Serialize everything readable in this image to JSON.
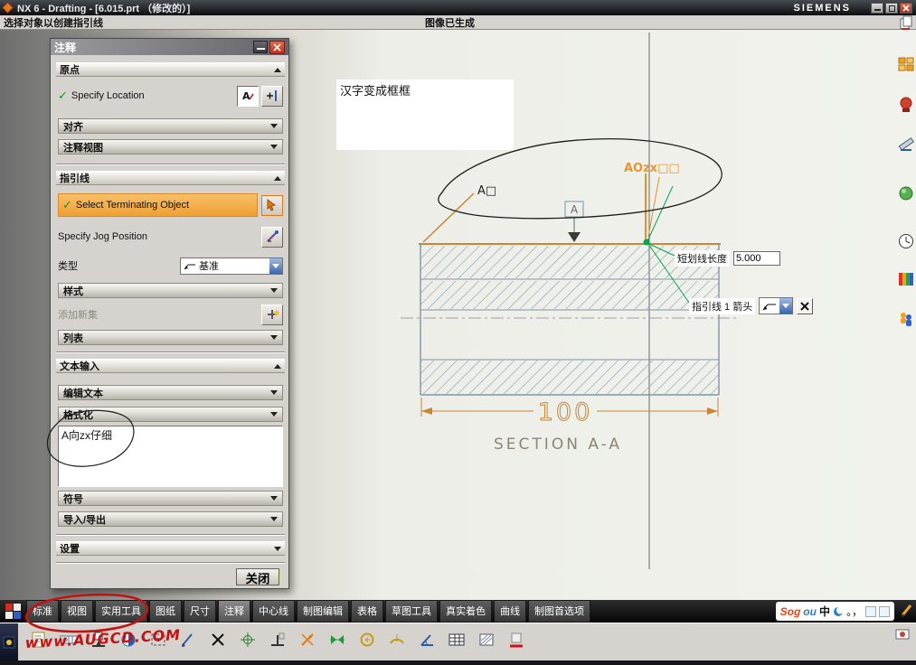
{
  "window": {
    "title": "NX 6 - Drafting - [6.015.prt （修改的）]",
    "brand": "SIEMENS"
  },
  "prompt": {
    "left": "选择对象以创建指引线",
    "status": "图像已生成"
  },
  "dialog": {
    "title": "注释",
    "check": "✓",
    "origin": {
      "header": "原点",
      "specify_location": "Specify Location",
      "align": "对齐",
      "view": "注释视图"
    },
    "leader": {
      "header": "指引线",
      "select_terminating": "Select Terminating Object",
      "jog": "Specify Jog Position",
      "type_label": "类型",
      "type_value": "基准",
      "style": "样式",
      "add_set": "添加新集",
      "list": "列表"
    },
    "text": {
      "header": "文本输入",
      "edit": "编辑文本",
      "format": "格式化",
      "content": "A向zx仔细",
      "symbols": "符号",
      "import_export": "导入/导出"
    },
    "settings_header": "设置",
    "close_button": "关闭"
  },
  "canvas": {
    "note": "汉字变成框框",
    "label_a": "A□",
    "datum": "A",
    "orange_text": "AOzx□□",
    "dash_label": "短划线长度",
    "dash_value": "5.000",
    "leader_label": "指引线 1 箭头",
    "dim": "100",
    "section": "SECTION A-A"
  },
  "tabs": {
    "items": [
      "标准",
      "视图",
      "实用工具",
      "图纸",
      "尺寸",
      "注释",
      "中心线",
      "制图编辑",
      "表格",
      "草图工具",
      "真实着色",
      "曲线",
      "制图首选项"
    ],
    "active": "注释"
  },
  "ime": {
    "brand_a": "Sog",
    "brand_b": "ou",
    "mode": "中",
    "punct": "。，"
  },
  "annotation": {
    "watermark": "www.AUGCD.COM"
  },
  "bottom_toolbar_icons": [
    "note-icon",
    "feature-control-frame-icon",
    "datum-feature-icon",
    "id-symbol-icon",
    "custom-symbol-icon",
    "edit-annotation-icon",
    "intersection-symbol-icon",
    "center-mark-icon",
    "datum-target-icon",
    "offset-center-point-icon",
    "centerline-2d-icon",
    "bolt-circle-icon",
    "circular-centerline-icon",
    "angle-dimension-icon",
    "table-icon",
    "section-hatch-icon",
    "highlight-mark-icon"
  ],
  "right_toolbar_icons": [
    "navigator-icon",
    "stamp-icon",
    "measure-icon",
    "material-icon",
    "history-icon",
    "palette-icon",
    "roles-icon"
  ],
  "colors": {
    "accent_orange": "#e07818",
    "dim_orange": "#c8863a",
    "leader_green": "#00a651",
    "hatch_blue": "#7e95a8",
    "highlight_orange": "#f0a238",
    "annotation_red": "#c41212"
  }
}
